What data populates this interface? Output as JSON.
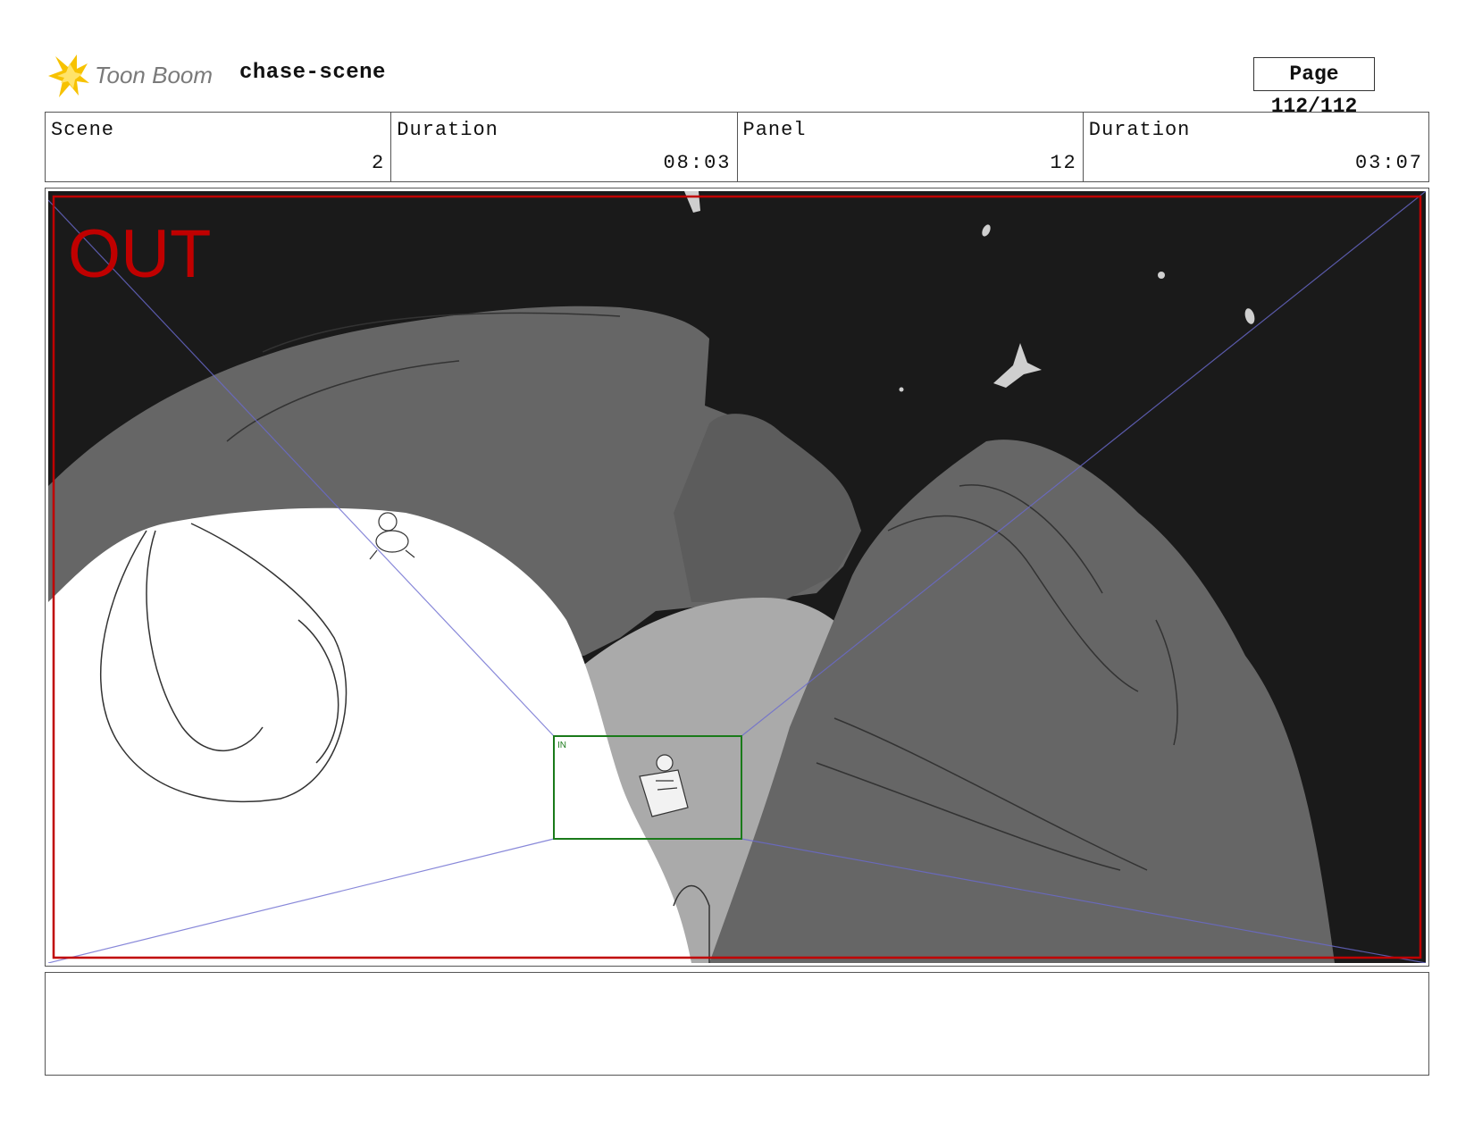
{
  "header": {
    "logo_text": "Toon Boom",
    "project_title": "chase-scene",
    "page_label": "Page 112/112"
  },
  "info": {
    "scene_label": "Scene",
    "scene_value": "2",
    "scene_duration_label": "Duration",
    "scene_duration_value": "08:03",
    "panel_label": "Panel",
    "panel_value": "12",
    "panel_duration_label": "Duration",
    "panel_duration_value": "03:07"
  },
  "panel": {
    "out_label": "OUT",
    "in_label": "IN",
    "out_color": "#c00000",
    "in_color": "#1a7a1a"
  },
  "notes": {
    "text": ""
  }
}
